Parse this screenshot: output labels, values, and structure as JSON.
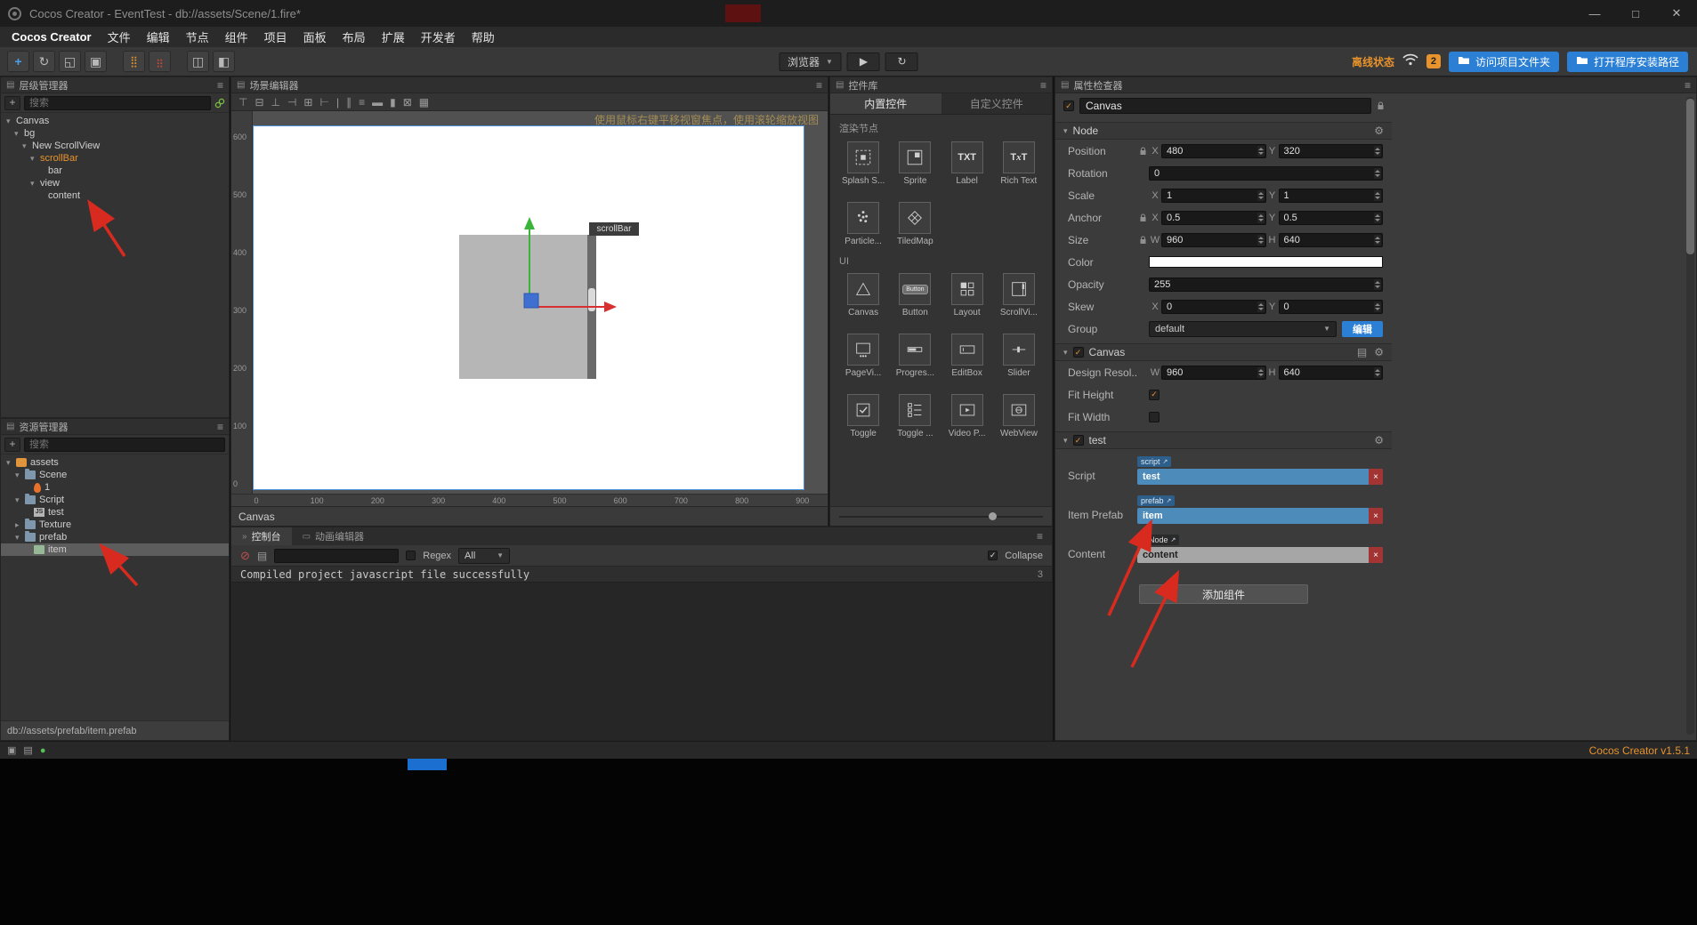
{
  "window": {
    "title": "Cocos Creator - EventTest - db://assets/Scene/1.fire*",
    "minimize": "—",
    "maximize": "□",
    "close": "✕"
  },
  "menu": {
    "items": [
      "Cocos Creator",
      "文件",
      "编辑",
      "节点",
      "组件",
      "项目",
      "面板",
      "布局",
      "扩展",
      "开发者",
      "帮助"
    ]
  },
  "toolbar": {
    "tools": [
      {
        "name": "move-tool-icon",
        "glyph": "+",
        "active": true
      },
      {
        "name": "rotate-tool-icon",
        "glyph": "↻"
      },
      {
        "name": "scale-tool-icon",
        "glyph": "◱"
      },
      {
        "name": "rect-tool-icon",
        "glyph": "▣"
      },
      {
        "name": "pivot-toggle-icon",
        "glyph": "⣿",
        "cls": "gap orange"
      },
      {
        "name": "coord-toggle-icon",
        "glyph": "⣶",
        "cls": "red"
      },
      {
        "name": "layout-split-icon",
        "glyph": "◫",
        "cls": "gap"
      },
      {
        "name": "layout-grid-icon",
        "glyph": "◧"
      }
    ],
    "preview_target": "浏览器",
    "play": "▶",
    "refresh": "↻",
    "status_text": "离线状态",
    "notification_count": "2",
    "open_project_folder": "访问项目文件夹",
    "open_install_path": "打开程序安装路径"
  },
  "hierarchy": {
    "title": "层级管理器",
    "search_placeholder": "搜索",
    "nodes": [
      {
        "label": "Canvas",
        "level": 0,
        "expand": true
      },
      {
        "label": "bg",
        "level": 1,
        "expand": true
      },
      {
        "label": "New ScrollView",
        "level": 2,
        "expand": true
      },
      {
        "label": "scrollBar",
        "level": 3,
        "expand": true,
        "selected": true
      },
      {
        "label": "bar",
        "level": 4
      },
      {
        "label": "view",
        "level": 3,
        "expand": true
      },
      {
        "label": "content",
        "level": 4
      }
    ]
  },
  "assets": {
    "title": "资源管理器",
    "search_placeholder": "搜索",
    "status": "db://assets/prefab/item.prefab",
    "nodes": [
      {
        "label": "assets",
        "level": 0,
        "expand": true,
        "icon": "db"
      },
      {
        "label": "Scene",
        "level": 1,
        "expand": true,
        "icon": "folder"
      },
      {
        "label": "1",
        "level": 2,
        "icon": "fire"
      },
      {
        "label": "Script",
        "level": 1,
        "expand": true,
        "icon": "folder"
      },
      {
        "label": "test",
        "level": 2,
        "icon": "js"
      },
      {
        "label": "Texture",
        "level": 1,
        "expand": false,
        "icon": "folder"
      },
      {
        "label": "prefab",
        "level": 1,
        "expand": true,
        "icon": "folder"
      },
      {
        "label": "item",
        "level": 2,
        "icon": "prefab",
        "selected": true
      }
    ]
  },
  "scene": {
    "title": "场景编辑器",
    "hint": "使用鼠标右键平移视窗焦点，使用滚轮缩放视图",
    "node_label": "scrollBar",
    "bottom_label": "Canvas",
    "ruler_v": [
      "600",
      "500",
      "400",
      "300",
      "200",
      "100",
      "0"
    ],
    "ruler_h": [
      "0",
      "100",
      "200",
      "300",
      "400",
      "500",
      "600",
      "700",
      "800",
      "900"
    ],
    "tools": [
      {
        "name": "align-top-icon",
        "glyph": "⊤"
      },
      {
        "name": "align-middle-icon",
        "glyph": "⊟"
      },
      {
        "name": "align-bottom-icon",
        "glyph": "⊥"
      },
      {
        "name": "align-left-icon",
        "glyph": "⊣"
      },
      {
        "name": "align-center-icon",
        "glyph": "⊞"
      },
      {
        "name": "align-right-icon",
        "glyph": "⊢"
      },
      {
        "name": "divider",
        "glyph": "|"
      },
      {
        "name": "distribute-horizontal-icon",
        "glyph": "∥"
      },
      {
        "name": "distribute-vertical-icon",
        "glyph": "≡"
      },
      {
        "name": "same-width-icon",
        "glyph": "▬"
      },
      {
        "name": "same-height-icon",
        "glyph": "▮"
      },
      {
        "name": "snap-icon",
        "glyph": "⊠"
      },
      {
        "name": "grid-icon",
        "glyph": "▦"
      }
    ]
  },
  "library": {
    "title": "控件库",
    "tabs": [
      {
        "label": "内置控件",
        "active": true
      },
      {
        "label": "自定义控件"
      }
    ],
    "section_render": "渲染节点",
    "section_ui": "UI",
    "render_items": [
      {
        "label": "Splash S...",
        "icon": "splash"
      },
      {
        "label": "Sprite",
        "icon": "sprite"
      },
      {
        "label": "Label",
        "icon": "label"
      },
      {
        "label": "Rich Text",
        "icon": "richtext"
      },
      {
        "label": "Particle...",
        "icon": "particle"
      },
      {
        "label": "TiledMap",
        "icon": "tiledmap"
      }
    ],
    "ui_items": [
      {
        "label": "Canvas",
        "icon": "canvas"
      },
      {
        "label": "Button",
        "icon": "button"
      },
      {
        "label": "Layout",
        "icon": "layout"
      },
      {
        "label": "ScrollVi...",
        "icon": "scrollview"
      },
      {
        "label": "PageVi...",
        "icon": "pageview"
      },
      {
        "label": "Progres...",
        "icon": "progress"
      },
      {
        "label": "EditBox",
        "icon": "editbox"
      },
      {
        "label": "Slider",
        "icon": "slider"
      },
      {
        "label": "Toggle",
        "icon": "toggle"
      },
      {
        "label": "Toggle ...",
        "icon": "togglegroup"
      },
      {
        "label": "Video P...",
        "icon": "video"
      },
      {
        "label": "WebView",
        "icon": "webview"
      }
    ]
  },
  "console": {
    "tabs": [
      {
        "label": "控制台",
        "icon": "»",
        "active": true
      },
      {
        "label": "动画编辑器",
        "icon": "▭"
      }
    ],
    "regex_label": "Regex",
    "filter_selected": "All",
    "collapse_label": "Collapse",
    "log_text": "Compiled project javascript file successfully",
    "log_count": "3"
  },
  "inspector": {
    "title": "属性检查器",
    "node_name": "Canvas",
    "axis": {
      "x": "X",
      "y": "Y",
      "w": "W",
      "h": "H"
    },
    "node": {
      "title": "Node",
      "position_label": "Position",
      "position_x": "480",
      "position_y": "320",
      "rotation_label": "Rotation",
      "rotation": "0",
      "scale_label": "Scale",
      "scale_x": "1",
      "scale_y": "1",
      "anchor_label": "Anchor",
      "anchor_x": "0.5",
      "anchor_y": "0.5",
      "size_label": "Size",
      "size_w": "960",
      "size_h": "640",
      "color_label": "Color",
      "opacity_label": "Opacity",
      "opacity": "255",
      "skew_label": "Skew",
      "skew_x": "0",
      "skew_y": "0",
      "group_label": "Group",
      "group_value": "default",
      "edit_button": "编辑"
    },
    "canvas": {
      "title": "Canvas",
      "design_label": "Design Resol...",
      "design_w": "960",
      "design_h": "640",
      "fit_height_label": "Fit Height",
      "fit_width_label": "Fit Width"
    },
    "test": {
      "title": "test",
      "script_label": "Script",
      "script_tag": "script",
      "script_value": "test",
      "prefab_label": "Item Prefab",
      "prefab_tag": "prefab",
      "prefab_value": "item",
      "content_label": "Content",
      "content_tag": "Node",
      "content_value": "content"
    },
    "add_component": "添加组件"
  },
  "footer": {
    "version": "Cocos Creator v1.5.1",
    "icons": [
      {
        "name": "layout-status-icon",
        "glyph": "▣"
      },
      {
        "name": "log-status-icon",
        "glyph": "▤"
      },
      {
        "name": "online-status-icon",
        "glyph": "●",
        "cls": "green"
      }
    ]
  },
  "icons": {
    "menu": "≡",
    "caret_down": "▼",
    "panel": "▤",
    "collapse": "▾",
    "expand": "▸",
    "clear": "⊘",
    "doc": "▤",
    "gear": "⚙",
    "close": "×",
    "check": "✓"
  }
}
